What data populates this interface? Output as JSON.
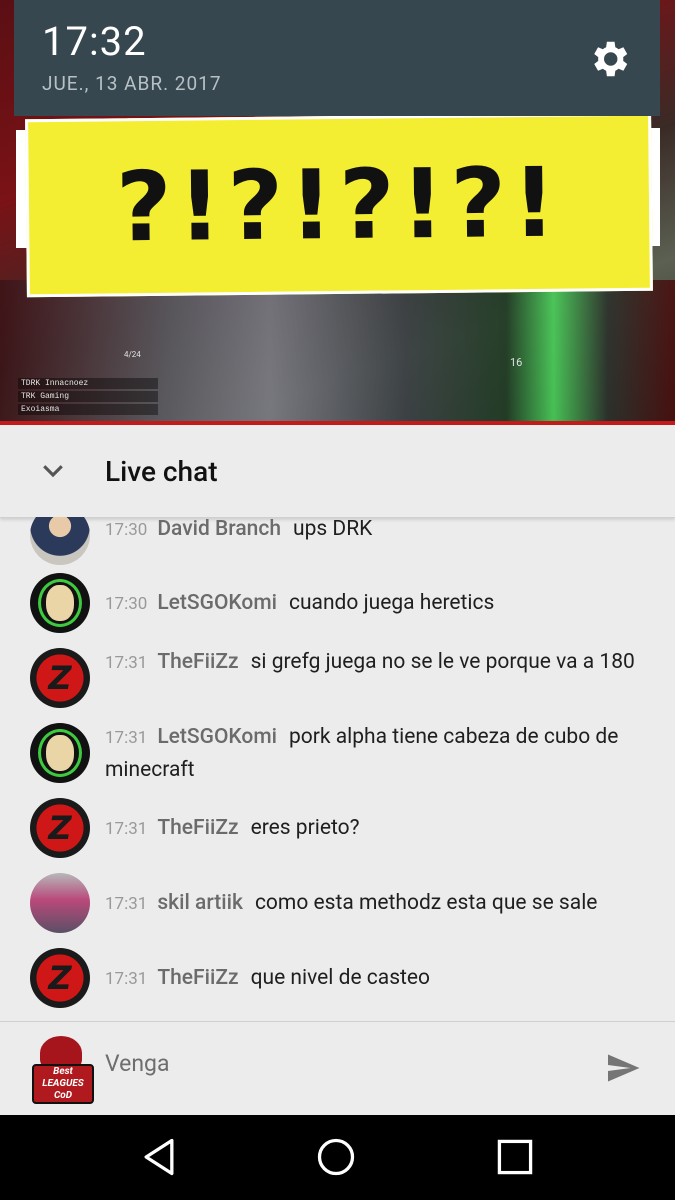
{
  "status_bar": {
    "time": "17:32",
    "date": "JUE., 13 ABR. 2017"
  },
  "video": {
    "banner_text": "?!?!?!?!",
    "hud_lines": [
      "TDRK Innacnoez",
      "TRK Gaming",
      "Exoiasma"
    ],
    "hud_counter": "4/24",
    "hud_number": "16"
  },
  "chat": {
    "title": "Live chat",
    "messages": [
      {
        "time": "17:30",
        "author": "David Branch",
        "text": "ups DRK"
      },
      {
        "time": "17:30",
        "author": "LetSGOKomi",
        "text": "cuando juega heretics"
      },
      {
        "time": "17:31",
        "author": "TheFiiZz",
        "text": "si grefg juega no se le ve porque va a 180"
      },
      {
        "time": "17:31",
        "author": "LetSGOKomi",
        "text": "pork alpha tiene cabeza de cubo de minecraft"
      },
      {
        "time": "17:31",
        "author": "TheFiiZz",
        "text": "eres prieto?"
      },
      {
        "time": "17:31",
        "author": "skil artiik",
        "text": "como esta methodz esta que se sale"
      },
      {
        "time": "17:31",
        "author": "TheFiiZz",
        "text": "que nivel de casteo"
      }
    ],
    "input_value": "Venga",
    "logo_text": "Best LEAGUES CoD"
  },
  "icons": {
    "settings": "gear-icon",
    "collapse": "chevron-down-icon",
    "send": "send-icon",
    "back": "back-icon",
    "home": "home-icon",
    "recents": "recents-icon"
  },
  "colors": {
    "status_bar": "#37474f",
    "banner": "#f3ee32",
    "chat_bg": "#ececec"
  }
}
